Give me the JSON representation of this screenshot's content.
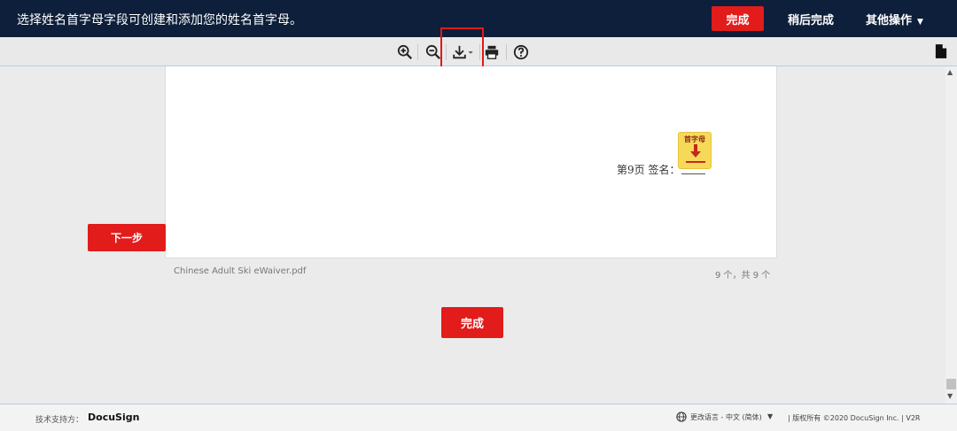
{
  "topbar": {
    "message": "选择姓名首字母字段可创建和添加您的姓名首字母。",
    "finish_label": "完成",
    "finish_later_label": "稍后完成",
    "other_actions_label": "其他操作",
    "caret": "▼"
  },
  "toolbar": {
    "icons": [
      "zoom-in-icon",
      "zoom-out-icon",
      "download-icon",
      "print-icon",
      "help-icon",
      "document-icon"
    ]
  },
  "document": {
    "signature_text": "第9页  签名：",
    "initial_tag_label": "首字母",
    "filename": "Chinese Adult Ski eWaiver.pdf",
    "page_count": "9 个，共 9 个"
  },
  "next_label": "下一步",
  "finish_main_label": "完成",
  "footer": {
    "support_label": "技术支持方：",
    "brand": "DocuSign",
    "language_label": "更改语言 - 中文 (简体)",
    "language_caret": "▼",
    "copyright": "|   版权所有 ©2020 DocuSign Inc. | V2R"
  },
  "colors": {
    "header_bg": "#0d1f3a",
    "accent_red": "#e21b1b",
    "initial_tag_bg": "#f7d95a"
  }
}
